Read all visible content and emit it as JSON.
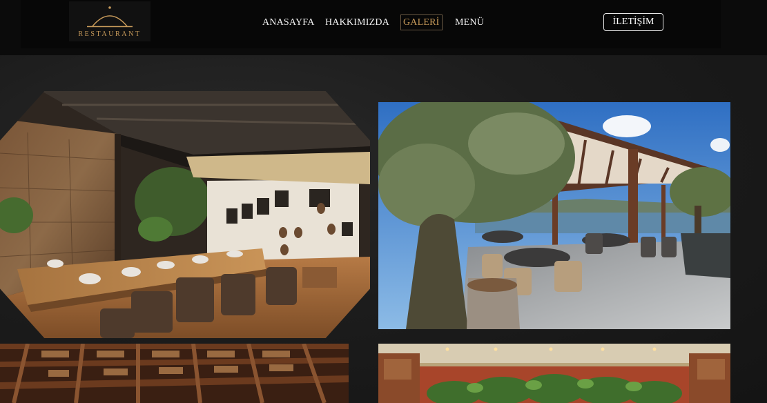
{
  "header": {
    "logo_text": "RESTAURANT",
    "nav": {
      "home": "ANASAYFA",
      "about": "HAKKIMIZDA",
      "gallery": "GALERİ",
      "menu": "MENÜ"
    },
    "contact_label": "İLETİŞİM"
  },
  "colors": {
    "accent": "#c79a5a",
    "header_bg": "#0b0b0b",
    "page_bg": "#1b1b1b"
  },
  "gallery": {
    "images": [
      "indoor-dining-photo",
      "terrace-dining-photo",
      "wooden-ceiling-photo",
      "green-wall-hall-photo"
    ]
  }
}
